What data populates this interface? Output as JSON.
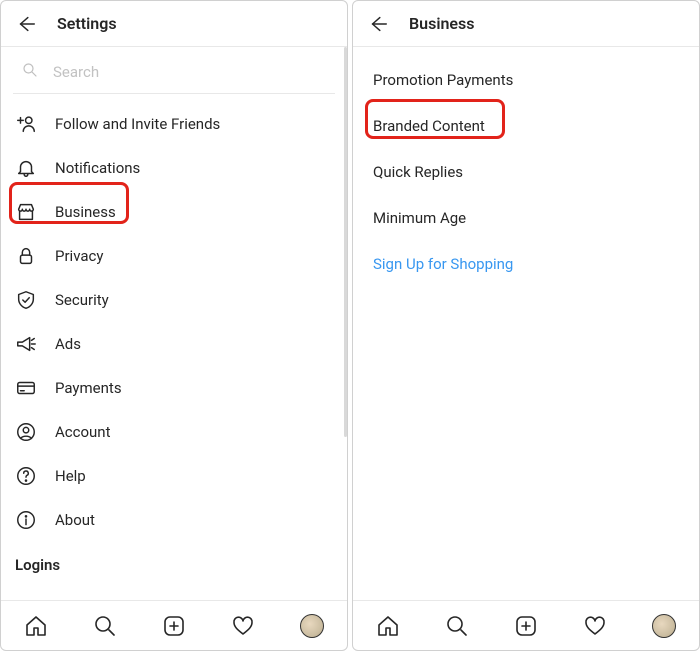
{
  "left": {
    "header_title": "Settings",
    "search_placeholder": "Search",
    "items": {
      "invite": "Follow and Invite Friends",
      "notifications": "Notifications",
      "business": "Business",
      "privacy": "Privacy",
      "security": "Security",
      "ads": "Ads",
      "payments": "Payments",
      "account": "Account",
      "help": "Help",
      "about": "About"
    },
    "logins_header": "Logins"
  },
  "right": {
    "header_title": "Business",
    "items": {
      "promo": "Promotion Payments",
      "branded": "Branded Content",
      "qreplies": "Quick Replies",
      "minage": "Minimum Age",
      "shopping": "Sign Up for Shopping"
    }
  }
}
